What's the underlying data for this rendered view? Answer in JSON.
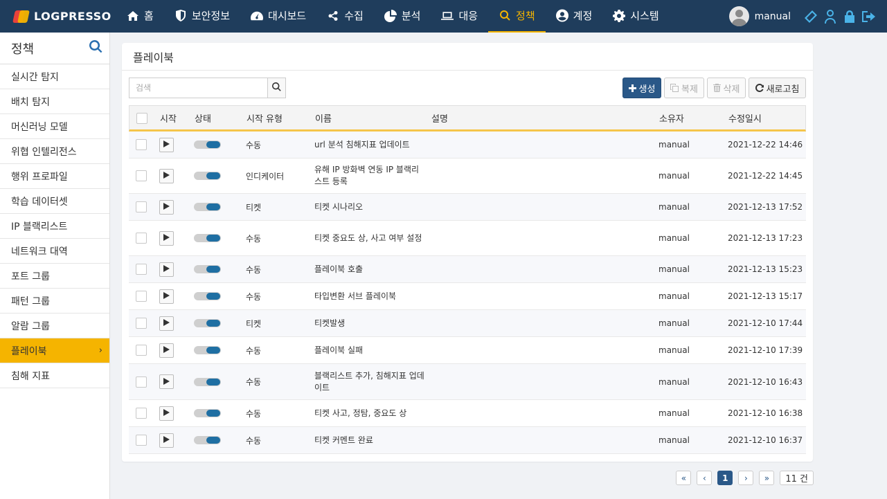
{
  "brand": {
    "name": "LOGPRESSO"
  },
  "topnav": {
    "items": [
      {
        "label": "홈",
        "icon": "home-icon"
      },
      {
        "label": "보안정보",
        "icon": "shield-icon"
      },
      {
        "label": "대시보드",
        "icon": "dashboard-icon"
      },
      {
        "label": "수집",
        "icon": "share-icon"
      },
      {
        "label": "분석",
        "icon": "pie-chart-icon"
      },
      {
        "label": "대응",
        "icon": "laptop-icon"
      },
      {
        "label": "정책",
        "icon": "search-icon"
      },
      {
        "label": "계정",
        "icon": "user-circle-icon"
      },
      {
        "label": "시스템",
        "icon": "gear-icon"
      }
    ],
    "active": "정책",
    "accent_color": "#f5b400",
    "bg_color": "#1f3d5c"
  },
  "user": {
    "name": "manual"
  },
  "sidebar": {
    "title": "정책",
    "items": [
      {
        "label": "실시간 탐지"
      },
      {
        "label": "배치 탐지"
      },
      {
        "label": "머신러닝 모델"
      },
      {
        "label": "위협 인텔리전스"
      },
      {
        "label": "행위 프로파일"
      },
      {
        "label": "학습 데이터셋"
      },
      {
        "label": "IP 블랙리스트"
      },
      {
        "label": "네트워크 대역"
      },
      {
        "label": "포트 그룹"
      },
      {
        "label": "패턴 그룹"
      },
      {
        "label": "알람 그룹"
      },
      {
        "label": "플레이북",
        "chevron": "›"
      },
      {
        "label": "침해 지표"
      }
    ],
    "active": "플레이북"
  },
  "panel": {
    "title": "플레이북",
    "search": {
      "placeholder": "검색",
      "value": ""
    },
    "buttons": {
      "create": "생성",
      "copy": "복제",
      "delete": "삭제",
      "refresh": "새로고침"
    },
    "columns": {
      "start": "시작",
      "status": "상태",
      "start_type": "시작 유형",
      "name": "이름",
      "description": "설명",
      "owner": "소유자",
      "modified": "수정일시"
    },
    "rows": [
      {
        "start_type": "수동",
        "name": "url 분석 침해지표 업데이트",
        "description": "",
        "owner": "manual",
        "modified": "2021-12-22 14:46",
        "enabled": true
      },
      {
        "start_type": "인디케이터",
        "name": "유해 IP 방화벽 연동 IP 블랙리스트 등록",
        "description": "",
        "owner": "manual",
        "modified": "2021-12-22 14:45",
        "enabled": true
      },
      {
        "start_type": "티켓",
        "name": "티켓 시나리오",
        "description": "",
        "owner": "manual",
        "modified": "2021-12-13 17:52",
        "enabled": true
      },
      {
        "start_type": "수동",
        "name": "티켓 중요도 상, 사고 여부 설정",
        "description": "",
        "owner": "manual",
        "modified": "2021-12-13 17:23",
        "enabled": true
      },
      {
        "start_type": "수동",
        "name": "플레이북 호출",
        "description": "",
        "owner": "manual",
        "modified": "2021-12-13 15:23",
        "enabled": true
      },
      {
        "start_type": "수동",
        "name": "타입변환 서브 플레이북",
        "description": "",
        "owner": "manual",
        "modified": "2021-12-13 15:17",
        "enabled": true
      },
      {
        "start_type": "티켓",
        "name": "티켓발생",
        "description": "",
        "owner": "manual",
        "modified": "2021-12-10 17:44",
        "enabled": true
      },
      {
        "start_type": "수동",
        "name": "플레이북 실패",
        "description": "",
        "owner": "manual",
        "modified": "2021-12-10 17:39",
        "enabled": true
      },
      {
        "start_type": "수동",
        "name": "블랙리스트 추가, 침해지표 업데이트",
        "description": "",
        "owner": "manual",
        "modified": "2021-12-10 16:43",
        "enabled": true
      },
      {
        "start_type": "수동",
        "name": "티켓 사고, 정탐, 중요도 상",
        "description": "",
        "owner": "manual",
        "modified": "2021-12-10 16:38",
        "enabled": true
      },
      {
        "start_type": "수동",
        "name": "티켓 커멘트 완료",
        "description": "",
        "owner": "manual",
        "modified": "2021-12-10 16:37",
        "enabled": true
      }
    ]
  },
  "pagination": {
    "first": "«",
    "prev": "‹",
    "current": "1",
    "next": "›",
    "last": "»",
    "total": "11 건"
  }
}
